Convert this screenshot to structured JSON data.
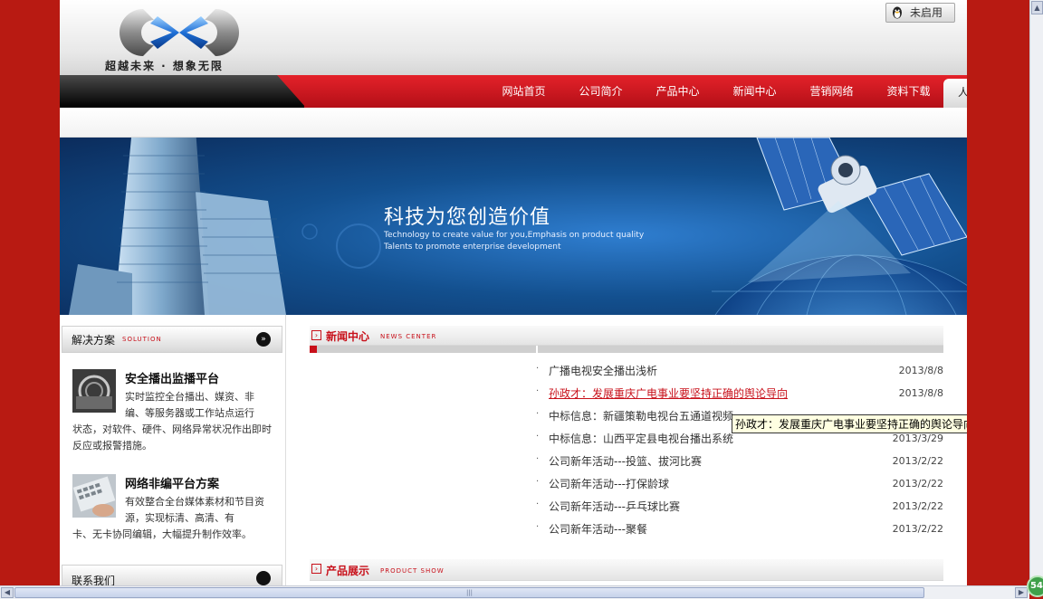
{
  "header": {
    "slogan": "超越未来 · 想象无限",
    "qq_status": "未启用"
  },
  "nav": {
    "items": [
      "网站首页",
      "公司简介",
      "产品中心",
      "新闻中心",
      "营销网络",
      "资料下载"
    ],
    "active": "人才招聘"
  },
  "banner": {
    "title": "科技为您创造价值",
    "sub1": "Technology to create value for you,Emphasis on product quality",
    "sub2": "Talents to promote enterprise development"
  },
  "sidebar": {
    "solution_title": "解决方案",
    "solution_en": "SOLUTION",
    "solutions": [
      {
        "title": "安全播出监播平台",
        "desc": "实时监控全台播出、媒资、非编、等服务器或工作站点运行",
        "desc2": "状态，对软件、硬件、网络异常状况作出即时反应或报警措施。"
      },
      {
        "title": "网络非编平台方案",
        "desc": "有效整合全台媒体素材和节目资源，实现标清、高清、有",
        "desc2": "卡、无卡协同编辑，大幅提升制作效率。"
      }
    ],
    "contact_title": "联系我们"
  },
  "news": {
    "title": "新闻中心",
    "title_en": "NEWS CENTER",
    "items": [
      {
        "text": "广播电视安全播出浅析",
        "date": "2013/8/8"
      },
      {
        "text": "孙政才：发展重庆广电事业要坚持正确的舆论导向",
        "date": "2013/8/8"
      },
      {
        "text": "中标信息：新疆策勒电视台五通道视频",
        "date": ""
      },
      {
        "text": "中标信息：山西平定县电视台播出系统",
        "date": "2013/3/29"
      },
      {
        "text": "公司新年活动---投篮、拔河比赛",
        "date": "2013/2/22"
      },
      {
        "text": "公司新年活动---打保龄球",
        "date": "2013/2/22"
      },
      {
        "text": "公司新年活动---乒乓球比赛",
        "date": "2013/2/22"
      },
      {
        "text": "公司新年活动---聚餐",
        "date": "2013/2/22"
      }
    ],
    "tooltip": "孙政才：发展重庆广电事业要坚持正确的舆论导向"
  },
  "products": {
    "title": "产品展示",
    "title_en": "PRODUCT SHOW"
  },
  "status": {
    "badge": "54"
  },
  "colors": {
    "brand_red": "#c8101a",
    "page_bg": "#b81a12"
  }
}
